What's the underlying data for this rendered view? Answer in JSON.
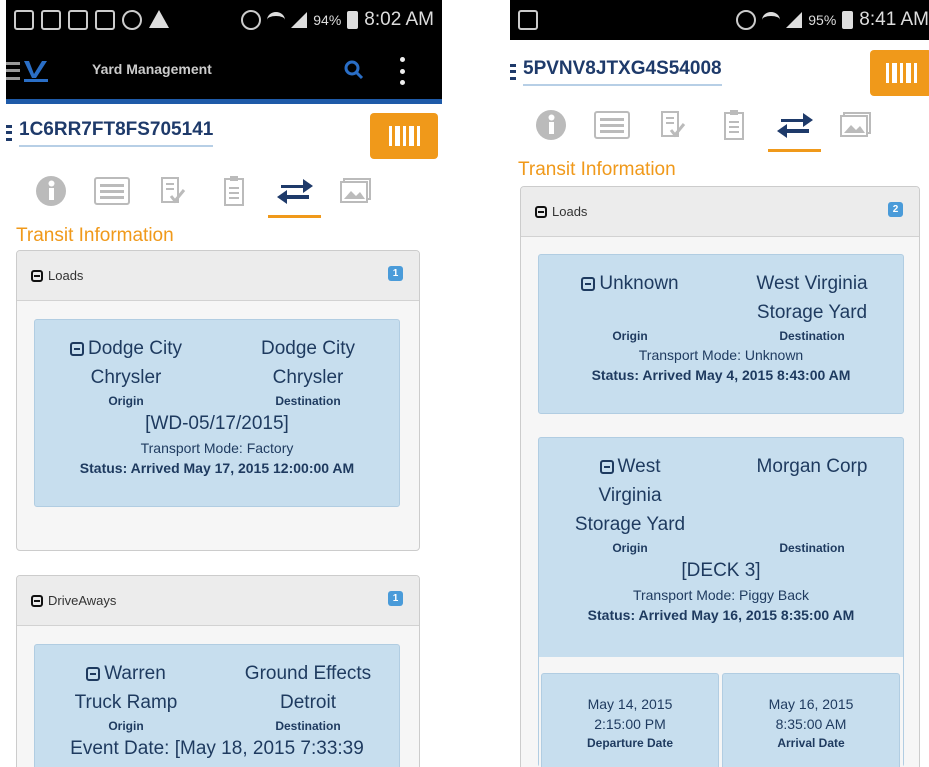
{
  "left": {
    "status": {
      "battery": "94%",
      "time": "8:02 AM"
    },
    "app_title": "Yard Management",
    "vin": "1C6RR7FT8FS705141",
    "section_title": "Transit Information",
    "loads": {
      "label": "Loads",
      "count": "1",
      "card": {
        "origin_line1": "Dodge City",
        "origin_line2": "Chrysler",
        "origin_label": "Origin",
        "dest_line1": "Dodge City",
        "dest_line2": "Chrysler",
        "dest_label": "Destination",
        "reference": "[WD-05/17/2015]",
        "transport_mode": "Transport Mode: Factory",
        "status": "Status: Arrived May 17, 2015 12:00:00 AM"
      }
    },
    "driveaways": {
      "label": "DriveAways",
      "count": "1",
      "card": {
        "origin_line1": "Warren",
        "origin_line2": "Truck Ramp",
        "origin_label": "Origin",
        "dest_line1": "Ground Effects",
        "dest_line2": "Detroit",
        "dest_label": "Destination",
        "event_date": "Event Date: [May 18, 2015 7:33:39"
      }
    }
  },
  "right": {
    "status": {
      "battery": "95%",
      "time": "8:41 AM"
    },
    "vin": "5PVNV8JTXG4S54008",
    "section_title": "Transit Information",
    "loads": {
      "label": "Loads",
      "count": "2",
      "card1": {
        "origin_line1": "Unknown",
        "origin_label": "Origin",
        "dest_line1": "West Virginia",
        "dest_line2": "Storage Yard",
        "dest_label": "Destination",
        "transport_mode": "Transport Mode: Unknown",
        "status": "Status: Arrived May 4, 2015 8:43:00 AM"
      },
      "card2": {
        "origin_line1": "West",
        "origin_line2": "Virginia",
        "origin_line3": "Storage Yard",
        "origin_label": "Origin",
        "dest_line1": "Morgan Corp",
        "dest_label": "Destination",
        "reference": "[DECK 3]",
        "transport_mode": "Transport Mode: Piggy Back",
        "status": "Status: Arrived May 16, 2015 8:35:00 AM"
      },
      "departure": {
        "date": "May 14, 2015",
        "time": "2:15:00 PM",
        "label": "Departure Date"
      },
      "arrival": {
        "date": "May 16, 2015",
        "time": "8:35:00 AM",
        "label": "Arrival Date"
      }
    }
  },
  "colors": {
    "accent": "#f0991a",
    "primary": "#1e3a6a",
    "card": "#c7deee",
    "badge": "#4a9bd9"
  }
}
